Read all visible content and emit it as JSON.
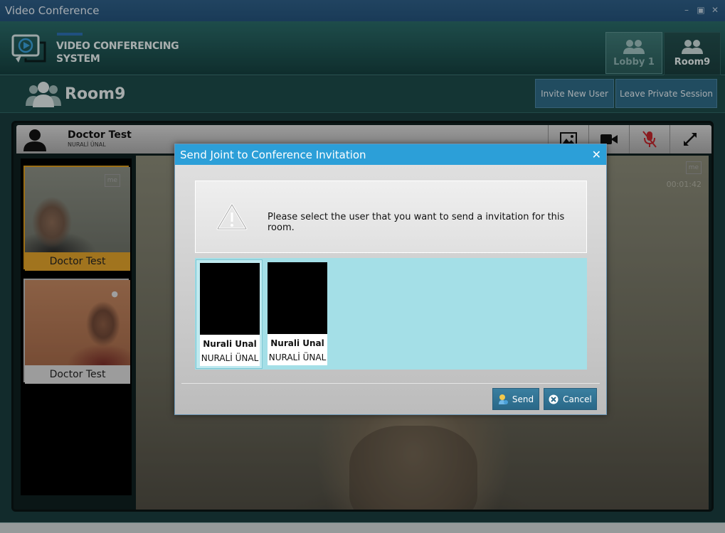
{
  "window": {
    "title": "Video Conference"
  },
  "header": {
    "logo_line1": "VIDEO CONFERENCING",
    "logo_line2": "SYSTEM",
    "tabs": [
      {
        "label": "Lobby 1",
        "active": false
      },
      {
        "label": "Room9",
        "active": true
      }
    ]
  },
  "roombar": {
    "room_name": "Room9",
    "invite_label": "Invite New User",
    "leave_label": "Leave Private Session"
  },
  "conference": {
    "user_name": "Doctor Test",
    "user_login": "NURALİ ÜNAL",
    "thumbnails": [
      {
        "caption": "Doctor Test",
        "tag": "me"
      },
      {
        "caption": "Doctor Test"
      }
    ],
    "main_tag": "me",
    "timer": "00:01:42"
  },
  "dialog": {
    "title": "Send Joint to Conference Invitation",
    "message": "Please select the user that you want to send a invitation for this room.",
    "users": [
      {
        "name": "Nurali Unal",
        "login": "NURALİ ÜNAL",
        "selected": true
      },
      {
        "name": "Nurali Unal",
        "login": "NURALİ ÜNAL",
        "selected": false
      }
    ],
    "send_label": "Send",
    "cancel_label": "Cancel"
  },
  "colors": {
    "accent": "#2c9fd8",
    "header_teal": "#1d4a49",
    "user_list_bg": "#a4dfe7",
    "active_thumb": "#e0a12a",
    "mic_muted": "#c0262c"
  }
}
